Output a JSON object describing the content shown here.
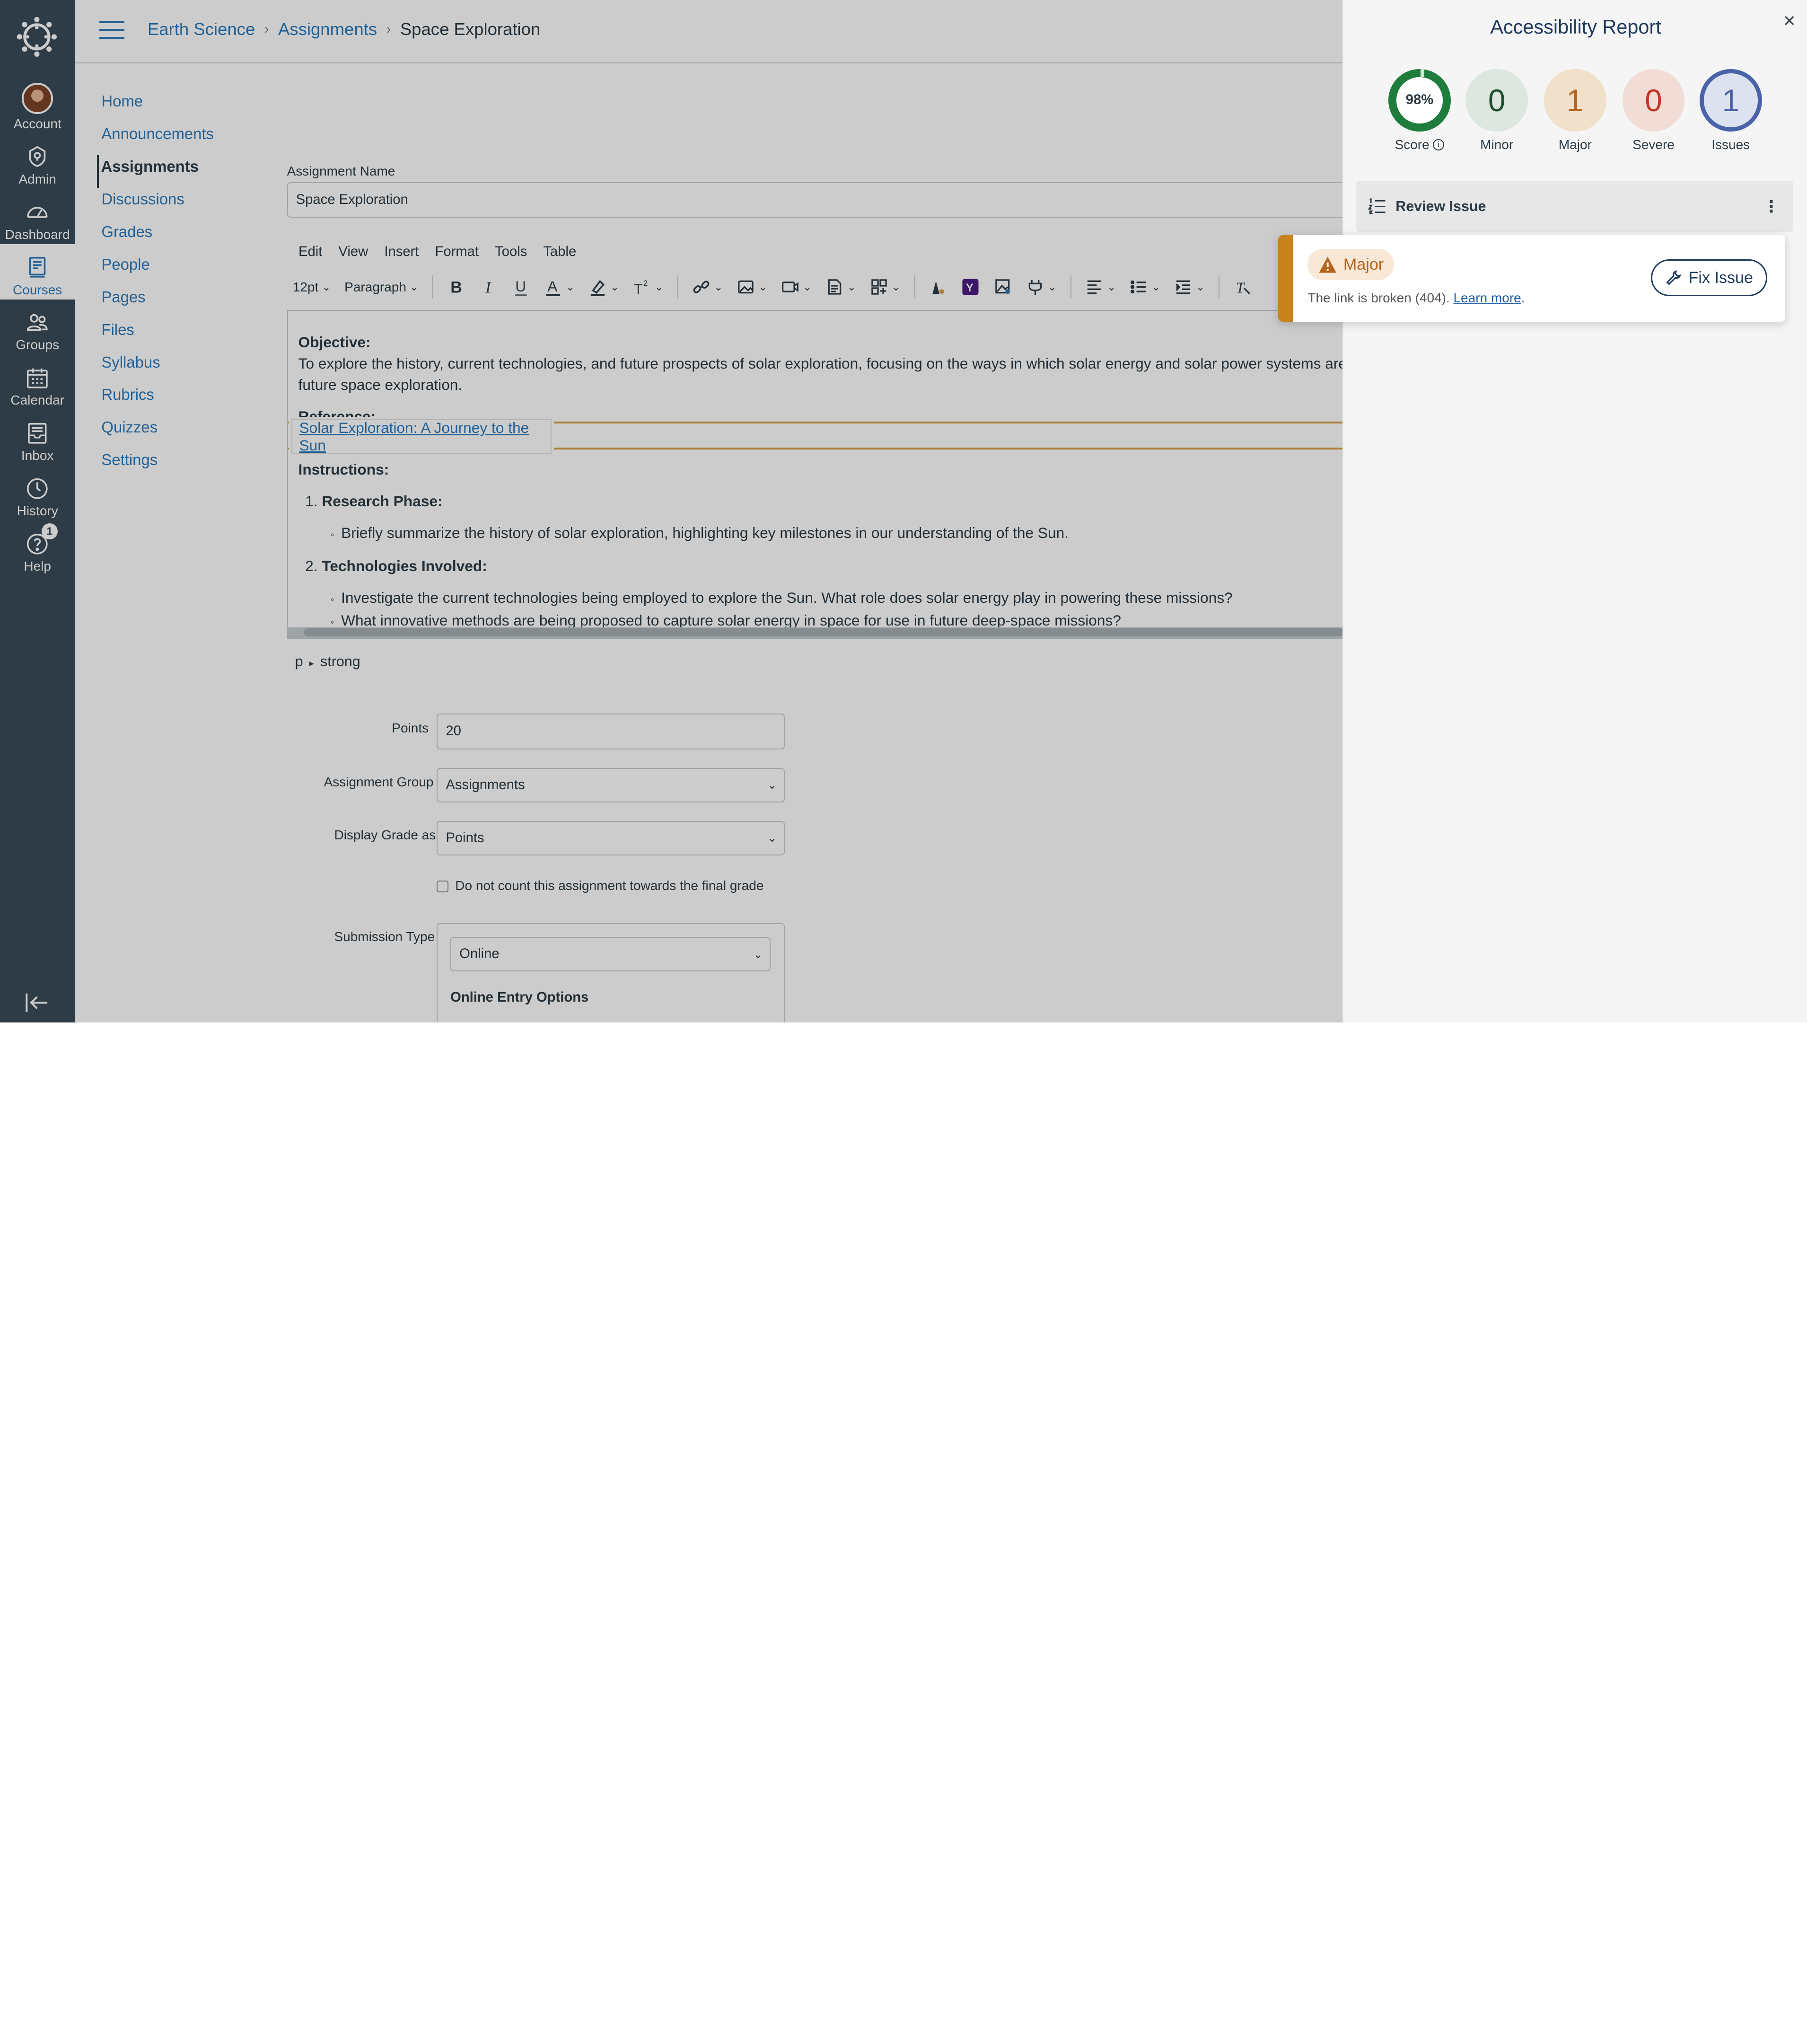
{
  "global_nav": {
    "items": [
      {
        "label": "Account",
        "icon": "avatar"
      },
      {
        "label": "Admin",
        "icon": "shield-icon"
      },
      {
        "label": "Dashboard",
        "icon": "speedometer-icon"
      },
      {
        "label": "Courses",
        "icon": "book-icon"
      },
      {
        "label": "Groups",
        "icon": "users-icon"
      },
      {
        "label": "Calendar",
        "icon": "calendar-icon"
      },
      {
        "label": "Inbox",
        "icon": "inbox-icon"
      },
      {
        "label": "History",
        "icon": "clock-icon"
      },
      {
        "label": "Help",
        "icon": "question-icon",
        "badge": "1"
      }
    ]
  },
  "breadcrumb": {
    "course": "Earth Science",
    "section": "Assignments",
    "current": "Space Exploration"
  },
  "course_nav": [
    "Home",
    "Announcements",
    "Assignments",
    "Discussions",
    "Grades",
    "People",
    "Pages",
    "Files",
    "Syllabus",
    "Rubrics",
    "Quizzes",
    "Settings"
  ],
  "form": {
    "name_label": "Assignment Name",
    "name_value": "Space Exploration",
    "menubar": [
      "Edit",
      "View",
      "Insert",
      "Format",
      "Tools",
      "Table"
    ],
    "font_size": "12pt",
    "block_format": "Paragraph",
    "editor": {
      "objective_heading": "Objective:",
      "objective_text": "To explore the history, current technologies, and future prospects of solar exploration, focusing on the ways in which solar energy and solar power systems are being used",
      "objective_text2": "future space exploration.",
      "reference_heading": "Reference:",
      "reference_link": "Solar Exploration: A Journey to the Sun",
      "instructions_heading": "Instructions:",
      "step1_num": "1.",
      "step1_title": "Research Phase:",
      "step1_bullet": "Briefly summarize the history of solar exploration, highlighting key milestones in our understanding of the Sun.",
      "step2_num": "2.",
      "step2_title": "Technologies Involved:",
      "step2_bullet1": "Investigate the current technologies being employed to explore the Sun. What role does solar energy play in powering these missions?",
      "step2_bullet2": "What innovative methods are being proposed to capture solar energy in space for use in future deep-space missions?"
    },
    "path_p": "p",
    "path_strong": "strong",
    "points_label": "Points",
    "points_value": "20",
    "group_label": "Assignment Group",
    "group_value": "Assignments",
    "display_label": "Display Grade as",
    "display_value": "Points",
    "checkbox_label": "Do not count this assignment towards the final grade",
    "submission_label": "Submission Type",
    "submission_value": "Online",
    "online_entry": "Online Entry Options"
  },
  "panel": {
    "title": "Accessibility Report",
    "close": "×",
    "score_value": "98%",
    "score_label": "Score",
    "minor_value": "0",
    "minor_label": "Minor",
    "major_value": "1",
    "major_label": "Major",
    "severe_value": "0",
    "severe_label": "Severe",
    "issues_value": "1",
    "issues_label": "Issues",
    "review_label": "Review Issue",
    "issue_severity": "Major",
    "issue_text": "The link is broken (404).",
    "learn_more": "Learn more",
    "fix_label": "Fix Issue"
  },
  "colors": {
    "nav_bg": "#394b58",
    "link": "#2b7abc",
    "score_ring": "#1e7d3c",
    "major": "#c8831f",
    "severe": "#c0392b",
    "issues": "#4a63a8",
    "fix_button": "#1f3a5c"
  }
}
